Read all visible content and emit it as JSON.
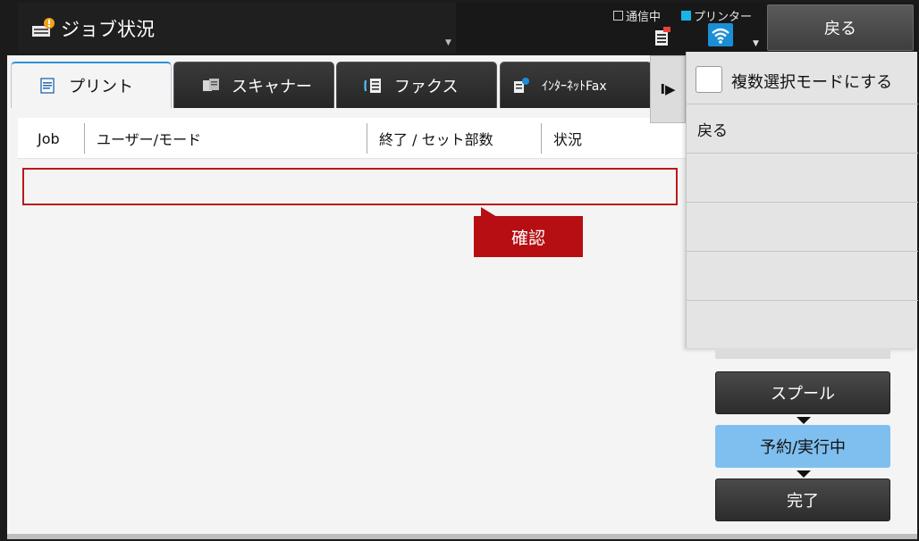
{
  "topbar": {
    "title": "ジョブ状況",
    "status_comm_label": "通信中",
    "status_printer_label": "プリンター",
    "back_label": "戻る",
    "colors": {
      "printer_flag": "#1ab3e6",
      "wifi_bg": "#1a8fd6"
    }
  },
  "tabs": [
    {
      "label": "プリント",
      "icon": "print-icon",
      "active": true
    },
    {
      "label": "スキャナー",
      "icon": "scanner-icon",
      "active": false
    },
    {
      "label": "ファクス",
      "icon": "fax-icon",
      "active": false
    },
    {
      "label": "ｲﾝﾀｰﾈｯﾄFax",
      "icon": "internet-fax-icon",
      "active": false
    }
  ],
  "table": {
    "columns": [
      "Job",
      "ユーザー/モード",
      "終了 / セット部数",
      "状況"
    ],
    "rows": []
  },
  "tooltip": {
    "label": "確認",
    "color": "#b60e12"
  },
  "menu": {
    "multi_select_label": "複数選択モードにする",
    "back_label": "戻る"
  },
  "side_buttons": {
    "spool_label": "スプール",
    "queue_label": "予約/実行中",
    "complete_label": "完了",
    "active_color": "#7fbfef"
  }
}
